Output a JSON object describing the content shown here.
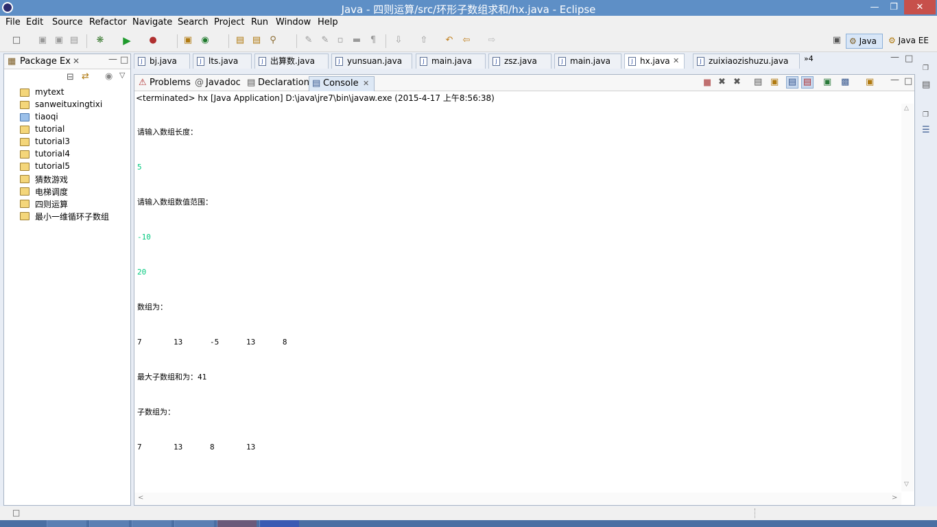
{
  "window": {
    "title": "Java - 四则运算/src/环形子数组求和/hx.java - Eclipse"
  },
  "menubar": [
    "File",
    "Edit",
    "Source",
    "Refactor",
    "Navigate",
    "Search",
    "Project",
    "Run",
    "Window",
    "Help"
  ],
  "perspectives": {
    "java": "Java",
    "javaee": "Java EE"
  },
  "package_explorer": {
    "title": "Package Ex",
    "items": [
      "mytext",
      "sanweituxingtixi",
      "tiaoqi",
      "tutorial",
      "tutorial3",
      "tutorial4",
      "tutorial5",
      "猜数游戏",
      "电梯调度",
      "四则运算",
      "最小一维循环子数组"
    ]
  },
  "editor_tabs": [
    "bj.java",
    "lts.java",
    "出算数.java",
    "yunsuan.java",
    "main.java",
    "zsz.java",
    "main.java",
    "hx.java",
    "zuixiaozishuzu.java"
  ],
  "editor_overflow": "»4",
  "bottom_tabs": [
    "Problems",
    "Javadoc",
    "Declaration",
    "Console"
  ],
  "console": {
    "command": "<terminated> hx [Java Application] D:\\java\\jre7\\bin\\javaw.exe (2015-4-17 上午8:56:38)",
    "lines": [
      {
        "text": "请输入数组长度：",
        "kind": "output"
      },
      {
        "text": "5",
        "kind": "input"
      },
      {
        "text": "请输入数组数值范围：",
        "kind": "output"
      },
      {
        "text": "-10",
        "kind": "input"
      },
      {
        "text": "20",
        "kind": "input"
      },
      {
        "text": "数组为：",
        "kind": "output"
      },
      {
        "text": "7       13      -5      13      8",
        "kind": "output"
      },
      {
        "text": "最大子数组和为：41",
        "kind": "output"
      },
      {
        "text": "子数组为：",
        "kind": "output"
      },
      {
        "text": "7       13      8       13",
        "kind": "output"
      }
    ]
  },
  "colors": {
    "titlebar": "#5e8fc6",
    "input_text": "#00c87d",
    "close_button": "#c7504b"
  }
}
